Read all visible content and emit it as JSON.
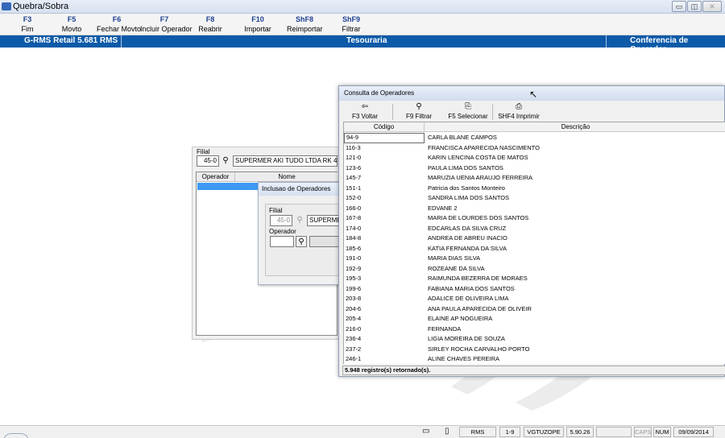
{
  "window": {
    "title": "Quebra/Sobra",
    "buttons": {
      "minimize": "▭",
      "maximize": "◫",
      "close": "✕"
    }
  },
  "fkeys": [
    {
      "key": "F3",
      "label": "Fim"
    },
    {
      "key": "F5",
      "label": "Movto"
    },
    {
      "key": "F6",
      "label": "Fechar Movto"
    },
    {
      "key": "F7",
      "label": "Incluir Operador"
    },
    {
      "key": "F8",
      "label": "Reabrir"
    },
    {
      "key": "F10",
      "label": "Importar"
    },
    {
      "key": "ShF8",
      "label": "Reimportar"
    },
    {
      "key": "ShF9",
      "label": "Filtrar"
    }
  ],
  "header": {
    "left": "G-RMS Retail 5.681 RMS",
    "center": "Tesouraria",
    "right": "Conferencia de Operador"
  },
  "backwin": {
    "filial_label": "Filial",
    "filial_code": "45-0",
    "filial_name": "SUPERMER AKI TUDO LTDA RK 45-0",
    "col_operador": "Operador",
    "col_nome": "Nome"
  },
  "inclusao": {
    "title": "Inclusao de Operadores",
    "filial_label": "Filial",
    "filial_code": "45-0",
    "filial_name": "SUPERMER",
    "operador_label": "Operador",
    "operador_value": ""
  },
  "consulta": {
    "title": "Consulta de Operadores",
    "toolbar": [
      {
        "icon": "⇦",
        "icon_name": "back-icon",
        "label": "F3 Voltar"
      },
      {
        "icon": "⚲",
        "icon_name": "binoculars-icon",
        "label": "F9 Filtrar"
      },
      {
        "icon": "⎘",
        "icon_name": "select-icon",
        "label": "F5 Selecionar"
      },
      {
        "icon": "⎙",
        "icon_name": "printer-icon",
        "label": "SHF4 Imprimir"
      }
    ],
    "columns": {
      "codigo": "Código",
      "descricao": "Descrição"
    },
    "rows": [
      {
        "codigo": "94-9",
        "descricao": "CARLA BLANE CAMPOS"
      },
      {
        "codigo": "116-3",
        "descricao": "FRANCISCA APARECIDA NASCIMENTO"
      },
      {
        "codigo": "121-0",
        "descricao": "KARIN LENCINA COSTA DE MATOS"
      },
      {
        "codigo": "123-6",
        "descricao": "PAULA LIMA DOS SANTOS"
      },
      {
        "codigo": "145-7",
        "descricao": "MARUZIA UENIA ARAUJO FERREIRA"
      },
      {
        "codigo": "151-1",
        "descricao": "Patricia dos Santos Monteiro"
      },
      {
        "codigo": "152-0",
        "descricao": "SANDRA LIMA DOS SANTOS"
      },
      {
        "codigo": "166-0",
        "descricao": "EDVANE 2"
      },
      {
        "codigo": "167-8",
        "descricao": "MARIA DE LOURDES DOS SANTOS"
      },
      {
        "codigo": "174-0",
        "descricao": "EDCARLAS DA SILVA CRUZ"
      },
      {
        "codigo": "184-8",
        "descricao": "ANDREA DE ABREU INACIO"
      },
      {
        "codigo": "185-6",
        "descricao": "KATIA FERNANDA DA SILVA"
      },
      {
        "codigo": "191-0",
        "descricao": "MARIA DIAS SILVA"
      },
      {
        "codigo": "192-9",
        "descricao": "ROZEANE DA SILVA"
      },
      {
        "codigo": "195-3",
        "descricao": "RAIMUNDA BEZERRA DE MORAES"
      },
      {
        "codigo": "199-6",
        "descricao": "FABIANA MARIA DOS SANTOS"
      },
      {
        "codigo": "203-8",
        "descricao": "ADALICE DE OLIVEIRA LIMA"
      },
      {
        "codigo": "204-6",
        "descricao": "ANA PAULA APARECIDA DE OLIVEIR"
      },
      {
        "codigo": "205-4",
        "descricao": "ELAINE AP NOGUEIRA"
      },
      {
        "codigo": "216-0",
        "descricao": "FERNANDA"
      },
      {
        "codigo": "236-4",
        "descricao": "LIGIA MOREIRA DE SOUZA"
      },
      {
        "codigo": "237-2",
        "descricao": "SIRLEY ROCHA CARVALHO PORTO"
      },
      {
        "codigo": "246-1",
        "descricao": "ALINE CHAVES PEREIRA"
      }
    ],
    "status": "5.948 registro(s) retornado(s)."
  },
  "statusbar": {
    "system": "RMS",
    "page": "1-9",
    "user": "VGTUZOPE",
    "version": "5.90.26",
    "caps": "CAPS",
    "num": "NUM",
    "date": "09/09/2014"
  },
  "colors": {
    "header_blue": "#0c5aa8",
    "selection_blue": "#3d9af2",
    "fkey_text": "#1d3f8f"
  }
}
